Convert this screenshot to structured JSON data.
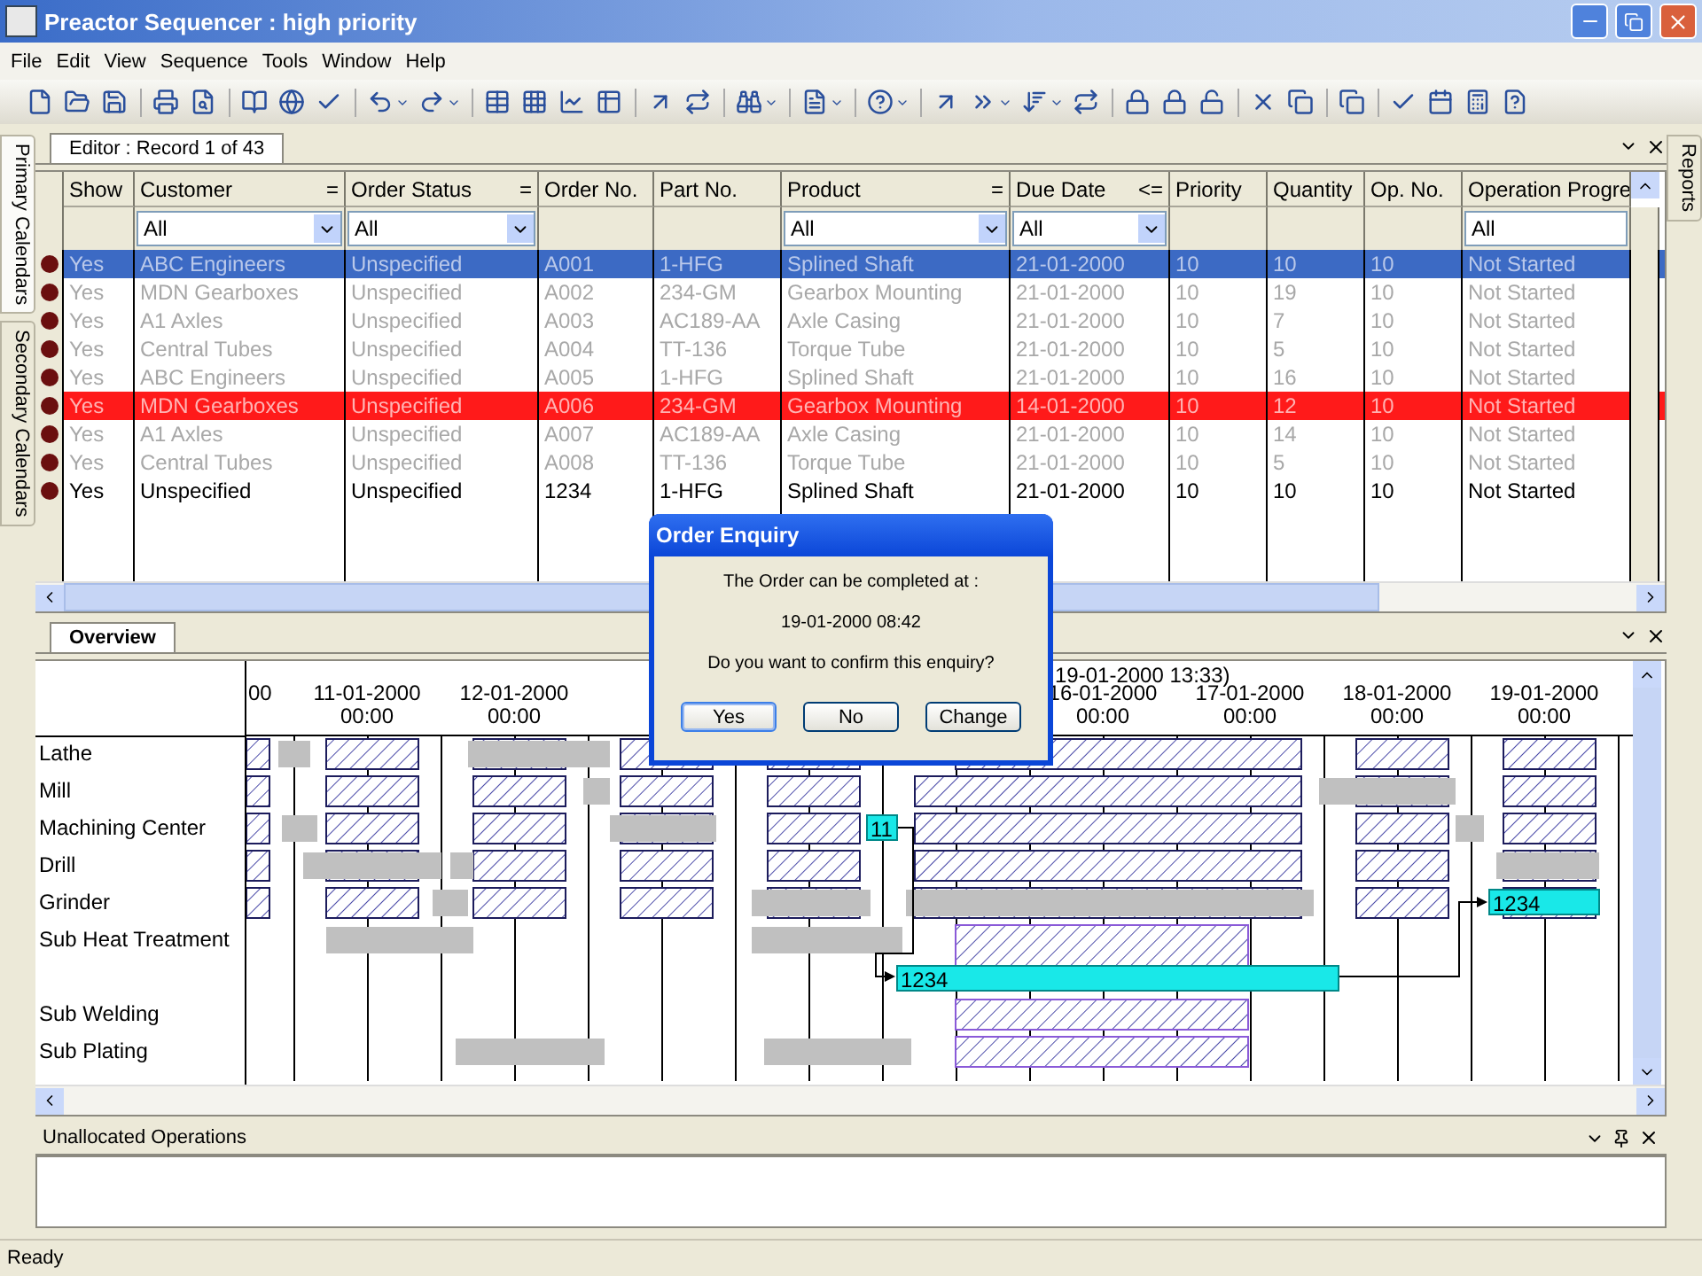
{
  "window": {
    "title": "Preactor Sequencer : high priority"
  },
  "menu": [
    "File",
    "Edit",
    "View",
    "Sequence",
    "Tools",
    "Window",
    "Help"
  ],
  "left_tabs": [
    {
      "label": "Primary Calendars",
      "selected": true
    },
    {
      "label": "Secondary Calendars",
      "selected": false
    }
  ],
  "right_tabs": [
    {
      "label": "Reports",
      "selected": false
    }
  ],
  "editor": {
    "tab": "Editor : Record 1 of 43",
    "columns": [
      {
        "label": "Show"
      },
      {
        "label": "Customer",
        "operator": "=",
        "filter": "All"
      },
      {
        "label": "Order Status",
        "operator": "=",
        "filter": "All"
      },
      {
        "label": "Order No."
      },
      {
        "label": "Part No."
      },
      {
        "label": "Product",
        "operator": "=",
        "filter": "All"
      },
      {
        "label": "Due Date",
        "operator": "<=",
        "filter": "All"
      },
      {
        "label": "Priority"
      },
      {
        "label": "Quantity"
      },
      {
        "label": "Op. No."
      },
      {
        "label": "Operation Progre",
        "filter": "All"
      }
    ],
    "rows": [
      {
        "cells": [
          "Yes",
          "ABC Engineers",
          "Unspecified",
          "A001",
          "1-HFG",
          "Splined Shaft",
          "21-01-2000",
          "10",
          "10",
          "10",
          "Not Started"
        ],
        "selected": true,
        "late": false,
        "dimmed": true
      },
      {
        "cells": [
          "Yes",
          "MDN Gearboxes",
          "Unspecified",
          "A002",
          "234-GM",
          "Gearbox Mounting",
          "21-01-2000",
          "10",
          "19",
          "10",
          "Not Started"
        ],
        "selected": false,
        "late": false,
        "dimmed": true
      },
      {
        "cells": [
          "Yes",
          "A1 Axles",
          "Unspecified",
          "A003",
          "AC189-AA",
          "Axle Casing",
          "21-01-2000",
          "10",
          "7",
          "10",
          "Not Started"
        ],
        "selected": false,
        "late": false,
        "dimmed": true
      },
      {
        "cells": [
          "Yes",
          "Central Tubes",
          "Unspecified",
          "A004",
          "TT-136",
          "Torque Tube",
          "21-01-2000",
          "10",
          "5",
          "10",
          "Not Started"
        ],
        "selected": false,
        "late": false,
        "dimmed": true
      },
      {
        "cells": [
          "Yes",
          "ABC Engineers",
          "Unspecified",
          "A005",
          "1-HFG",
          "Splined Shaft",
          "21-01-2000",
          "10",
          "16",
          "10",
          "Not Started"
        ],
        "selected": false,
        "late": false,
        "dimmed": true
      },
      {
        "cells": [
          "Yes",
          "MDN Gearboxes",
          "Unspecified",
          "A006",
          "234-GM",
          "Gearbox Mounting",
          "14-01-2000",
          "10",
          "12",
          "10",
          "Not Started"
        ],
        "selected": false,
        "late": true,
        "dimmed": true
      },
      {
        "cells": [
          "Yes",
          "A1 Axles",
          "Unspecified",
          "A007",
          "AC189-AA",
          "Axle Casing",
          "21-01-2000",
          "10",
          "14",
          "10",
          "Not Started"
        ],
        "selected": false,
        "late": false,
        "dimmed": true
      },
      {
        "cells": [
          "Yes",
          "Central Tubes",
          "Unspecified",
          "A008",
          "TT-136",
          "Torque Tube",
          "21-01-2000",
          "10",
          "5",
          "10",
          "Not Started"
        ],
        "selected": false,
        "late": false,
        "dimmed": true
      },
      {
        "cells": [
          "Yes",
          "Unspecified",
          "Unspecified",
          "1234",
          "1-HFG",
          "Splined Shaft",
          "21-01-2000",
          "10",
          "10",
          "10",
          "Not Started"
        ],
        "selected": false,
        "late": false,
        "dimmed": false
      }
    ]
  },
  "overview": {
    "tab": "Overview",
    "resources": [
      "Lathe",
      "Mill",
      "Machining Center",
      "Drill",
      "Grinder",
      "Sub Heat Treatment",
      "Sub Welding",
      "Sub Plating"
    ],
    "dates": [
      {
        "date": "00"
      },
      {
        "date": "11-01-2000",
        "time": "00:00"
      },
      {
        "date": "12-01-2000",
        "time": "00:00"
      },
      {
        "date": "16-01-2000",
        "time": "00:00"
      },
      {
        "date": "17-01-2000",
        "time": "00:00"
      },
      {
        "date": "18-01-2000",
        "time": "00:00"
      },
      {
        "date": "19-01-2000",
        "time": "00:00"
      }
    ],
    "marker": "19-01-2000 13:33)",
    "bar_labels": [
      "11",
      "1234",
      "1234"
    ]
  },
  "unallocated": {
    "title": "Unallocated Operations"
  },
  "status_bar": "Ready",
  "dialog": {
    "title": "Order Enquiry",
    "message": "The Order can be completed at :",
    "date": "19-01-2000 08:42",
    "question": "Do you want to confirm this enquiry?",
    "buttons": [
      {
        "label": "Yes",
        "default": true
      },
      {
        "label": "No",
        "default": false
      },
      {
        "label": "Change",
        "default": false
      }
    ]
  }
}
